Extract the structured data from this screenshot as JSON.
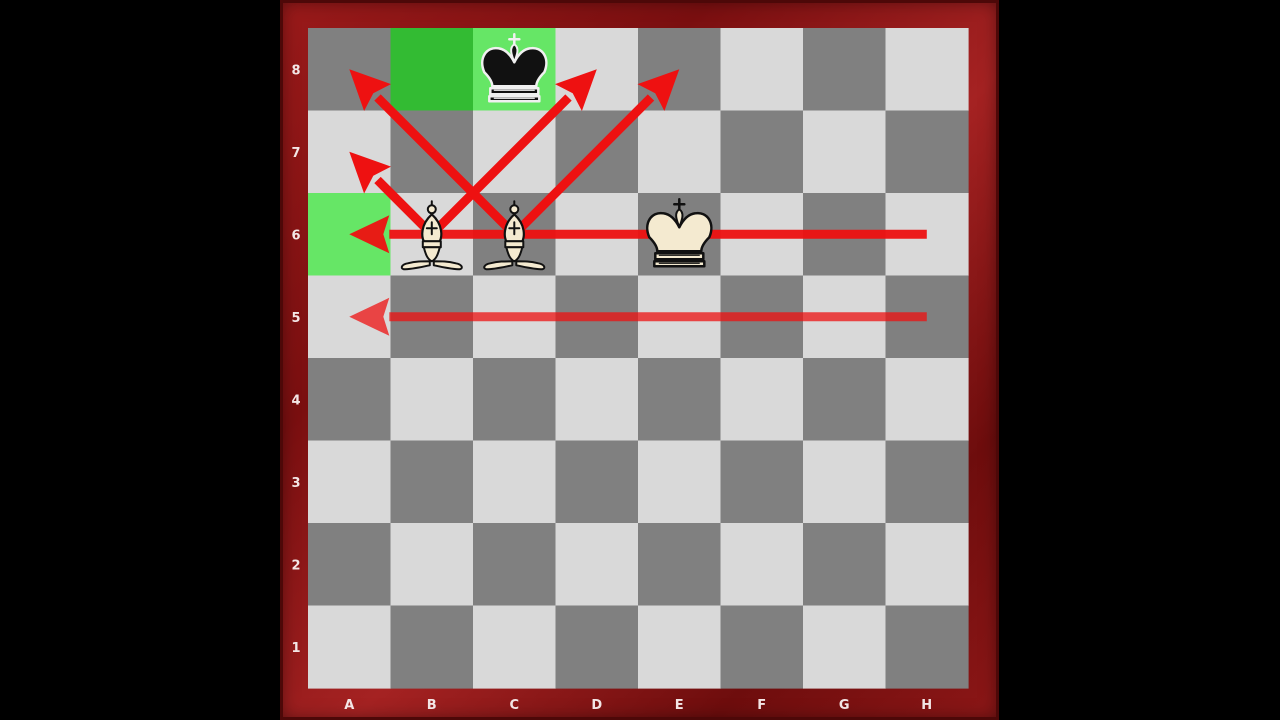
{
  "board": {
    "files": [
      "A",
      "B",
      "C",
      "D",
      "E",
      "F",
      "G",
      "H"
    ],
    "ranks": [
      "8",
      "7",
      "6",
      "5",
      "4",
      "3",
      "2",
      "1"
    ],
    "colors": {
      "light_square": "#d9d9d9",
      "dark_square": "#808080",
      "highlight_light": "#66e666",
      "highlight_dark": "#33bb33",
      "arrow": "#ee1111",
      "frame": "#8a1414"
    }
  },
  "pieces": [
    {
      "type": "king",
      "color": "black",
      "square": "c8",
      "icon": "black-king-icon"
    },
    {
      "type": "bishop",
      "color": "white",
      "square": "b6",
      "icon": "white-bishop-icon"
    },
    {
      "type": "bishop",
      "color": "white",
      "square": "c6",
      "icon": "white-bishop-icon"
    },
    {
      "type": "king",
      "color": "white",
      "square": "e6",
      "icon": "white-king-icon"
    }
  ],
  "highlights": [
    {
      "square": "a6",
      "shade": "light"
    },
    {
      "square": "b8",
      "shade": "dark"
    },
    {
      "square": "c8",
      "shade": "light"
    }
  ],
  "arrows": [
    {
      "from": "b6",
      "to": "a7",
      "opacity": 1
    },
    {
      "from": "b6",
      "to": "d8",
      "opacity": 1
    },
    {
      "from": "c6",
      "to": "a8",
      "opacity": 1
    },
    {
      "from": "c6",
      "to": "e8",
      "opacity": 1
    },
    {
      "from": "h6",
      "to": "a6",
      "opacity": 0.95
    },
    {
      "from": "h5",
      "to": "a5",
      "opacity": 0.75
    }
  ]
}
